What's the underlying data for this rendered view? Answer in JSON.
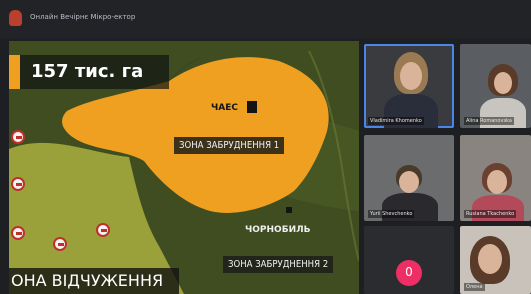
{
  "window": {
    "title": "Онлайн Вечірнє Мікро-ектор"
  },
  "screen_share": {
    "area_value": "157 тис. га",
    "labels": {
      "chaes": "ЧАЕС",
      "zone1": "ЗОНА ЗАБРУДНЕННЯ 1",
      "chornobyl": "ЧОРНОБИЛЬ",
      "zone2": "ЗОНА ЗАБРУДНЕННЯ 2",
      "exclusion_zone": "ОНА ВІДЧУЖЕННЯ"
    },
    "colors": {
      "contamination_zone": "#f0a020",
      "outer_area": "#9aa03a",
      "terrain": "#3f4d20"
    }
  },
  "participants": [
    {
      "name": "Vladimira Khomenko",
      "active": true
    },
    {
      "name": "Alina Romanovska",
      "active": false
    },
    {
      "name": "Yurii Shevchenko",
      "active": false
    },
    {
      "name": "Ruslana Tkachenko",
      "active": false
    },
    {
      "name": "Олена",
      "active": false
    }
  ],
  "controls": {
    "mic_icon": "mic-icon",
    "mic_glyph": "0",
    "accent": "#ee2f66",
    "active_outline": "#4a86e8"
  }
}
